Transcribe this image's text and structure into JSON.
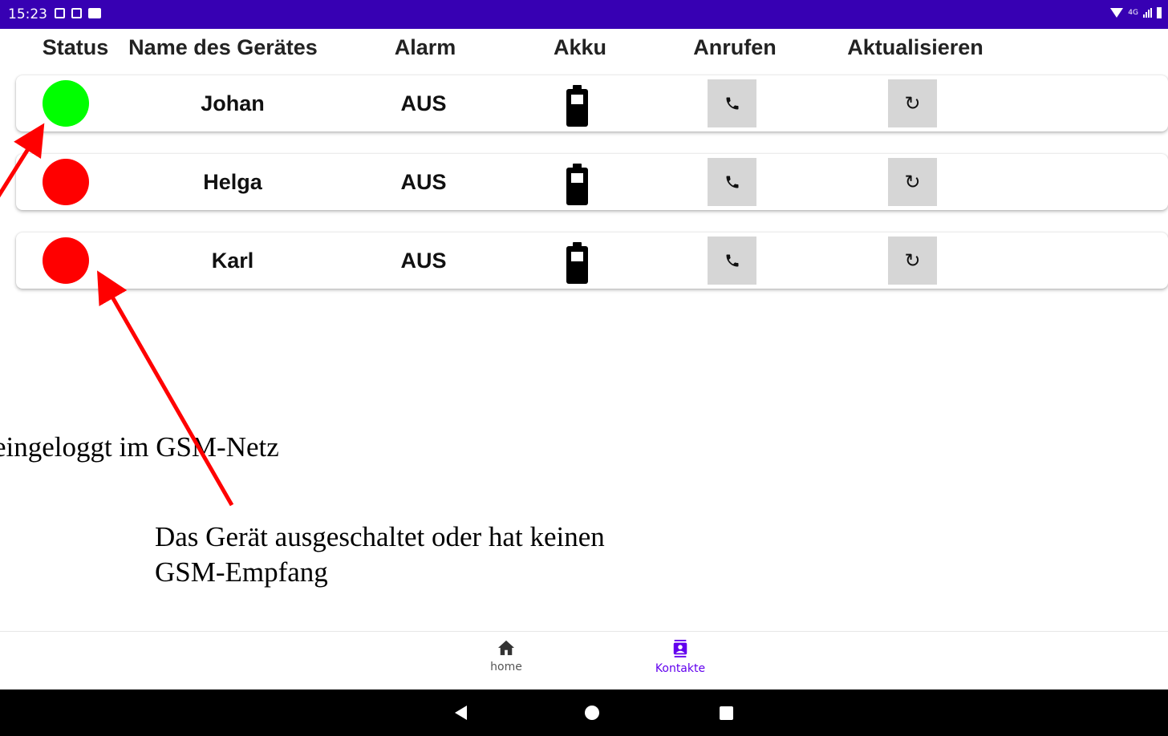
{
  "statusbar": {
    "time": "15:23",
    "network": "4G"
  },
  "header": {
    "status": "Status",
    "name": "Name des Gerätes",
    "alarm": "Alarm",
    "akku": "Akku",
    "anrufen": "Anrufen",
    "aktualisieren": "Aktualisieren"
  },
  "devices": [
    {
      "name": "Johan",
      "alarm": "AUS",
      "status_color": "#00ff00"
    },
    {
      "name": "Helga",
      "alarm": "AUS",
      "status_color": "#ff0000"
    },
    {
      "name": "Karl",
      "alarm": "AUS",
      "status_color": "#ff0000"
    }
  ],
  "icons": {
    "call": "phone-icon",
    "refresh": "refresh-icon",
    "battery": "battery-icon"
  },
  "annotations": {
    "online": "eingeloggt im GSM-Netz",
    "offline_line1": "Das Gerät ausgeschaltet oder hat keinen",
    "offline_line2": "GSM-Empfang"
  },
  "bottom_nav": {
    "home": "home",
    "kontakte": "Kontakte",
    "active": "kontakte",
    "active_color": "#6200ee"
  },
  "colors": {
    "statusbar": "#3700b3",
    "arrow": "#ff0000",
    "button_bg": "#d6d6d6"
  }
}
